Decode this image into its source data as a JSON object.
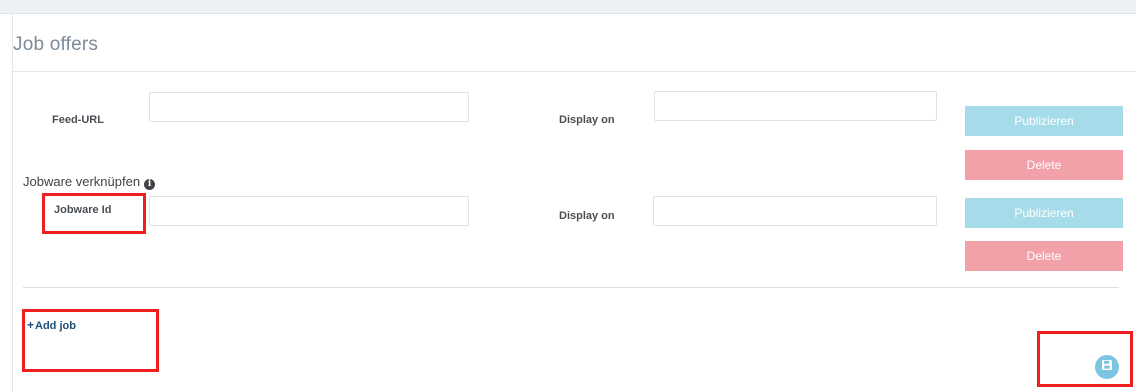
{
  "panel": {
    "title": "Job offers"
  },
  "feed_row": {
    "label": "Feed-URL",
    "input_value": "",
    "display_label": "Display on",
    "display_value": "",
    "publish_label": "Publizieren",
    "delete_label": "Delete"
  },
  "jobware": {
    "section_title": "Jobware verknüpfen",
    "info_glyph": "i",
    "label": "Jobware Id",
    "input_value": "",
    "display_label": "Display on",
    "display_value": "",
    "publish_label": "Publizieren",
    "delete_label": "Delete"
  },
  "actions": {
    "add_job_plus": "+",
    "add_job_label": "Add job",
    "save_icon": "save-icon"
  },
  "colors": {
    "publish": "#a6dcea",
    "delete": "#f2a1a9",
    "highlight": "#ee1f1f",
    "link": "#1f4f7a",
    "save": "#7cc5e0"
  }
}
